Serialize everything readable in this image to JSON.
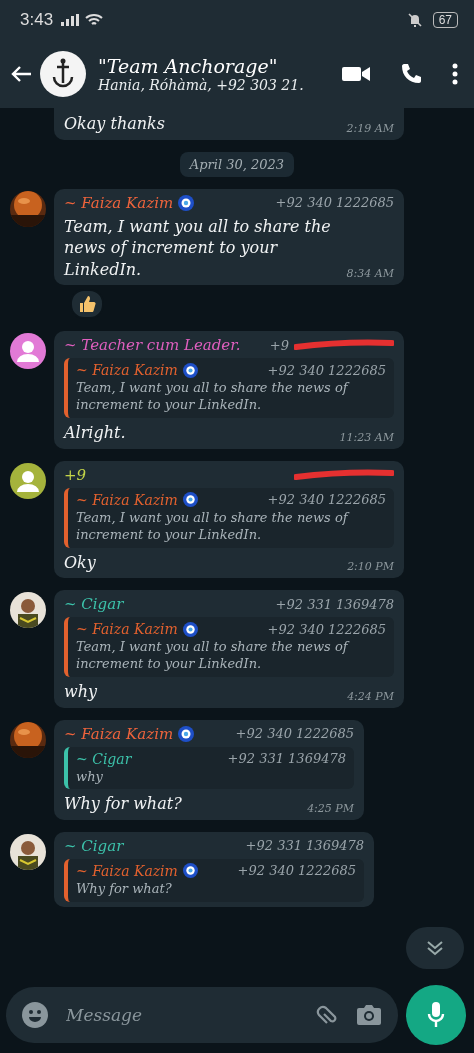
{
  "status_bar": {
    "time": "3:43",
    "battery": "67"
  },
  "header": {
    "title": "\"Team Anchorage\"",
    "subtitle": "Hania, Róhàmà, +92 303 21."
  },
  "messages": [
    {
      "kind": "tail",
      "text": "Okay thanks",
      "time": "2:19 AM"
    },
    {
      "kind": "date",
      "text": "April 30, 2023"
    },
    {
      "kind": "message",
      "sender": "~ Faiza Kazim",
      "color": "#f0643c",
      "eye": true,
      "number": "+92 340 1222685",
      "text": "Team, I want you all to share the news of increment to your LinkedIn.",
      "time": "8:34 AM",
      "reaction": true
    },
    {
      "kind": "message",
      "avatar": {
        "kind": "default",
        "color": "#e27ad6"
      },
      "sender": "~ Teacher cum Leader.",
      "color": "#e05fbf",
      "number": "+9",
      "redacted": true,
      "quote": {
        "sender": "~ Faiza Kazim",
        "color": "#e3612e",
        "eye": true,
        "number": "+92 340 1222685",
        "text": "Team, I want you all to share the news of increment to your LinkedIn."
      },
      "text": "Alright.",
      "time": "11:23 AM"
    },
    {
      "kind": "message",
      "avatar": {
        "kind": "default",
        "color": "#a5b33c"
      },
      "sender": "+9",
      "color": "#c3d448",
      "redacted": true,
      "quote": {
        "sender": "~ Faiza Kazim",
        "color": "#e3612e",
        "eye": true,
        "number": "+92 340 1222685",
        "text": "Team, I want you all to share the news of increment to your LinkedIn."
      },
      "text": "Oky",
      "time": "2:10 PM"
    },
    {
      "kind": "message",
      "avatar": {
        "kind": "photo2"
      },
      "sender": "~ Cigar",
      "color": "#3cc2aa",
      "number": "+92 331 1369478",
      "quote": {
        "sender": "~ Faiza Kazim",
        "color": "#e3612e",
        "eye": true,
        "number": "+92 340 1222685",
        "text": "Team, I want you all to share the news of increment to your LinkedIn."
      },
      "text": "why",
      "time": "4:24 PM"
    },
    {
      "kind": "message",
      "sender": "~ Faiza Kazim",
      "color": "#f0643c",
      "eye": true,
      "number": "+92 340 1222685",
      "quote": {
        "sender": "~ Cigar",
        "color": "#3cc2aa",
        "number": "+92 331 1369478",
        "text": "why"
      },
      "text": "Why for what?",
      "time": "4:25 PM"
    },
    {
      "kind": "message",
      "avatar": {
        "kind": "photo2"
      },
      "sender": "~ Cigar",
      "color": "#3cc2aa",
      "number": "+92 331 1369478",
      "quote": {
        "sender": "~ Faiza Kazim",
        "color": "#e3612e",
        "eye": true,
        "number": "+92 340 1222685",
        "text": "Why for what?"
      }
    }
  ],
  "composer": {
    "placeholder": "Message"
  }
}
